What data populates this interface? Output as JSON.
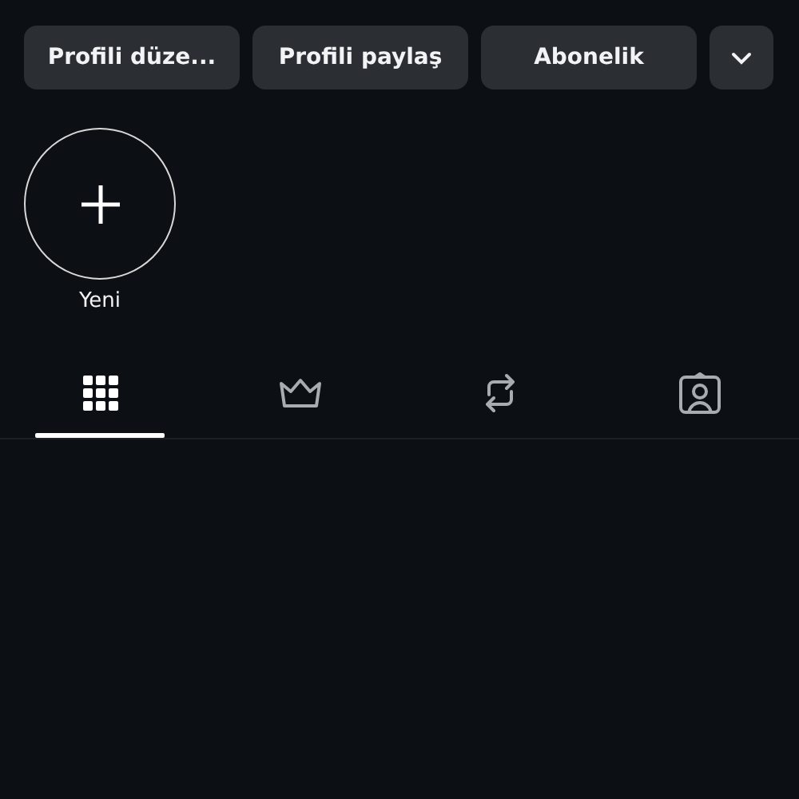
{
  "actions": [
    {
      "label": "Profili düze..."
    },
    {
      "label": "Profili paylaş"
    },
    {
      "label": "Abonelik"
    }
  ],
  "more_button": {
    "kind": "chevron"
  },
  "highlights": [
    {
      "label": "Yeni",
      "kind": "new"
    }
  ],
  "tabs": [
    {
      "kind": "grid",
      "selected": true
    },
    {
      "kind": "crown",
      "selected": false
    },
    {
      "kind": "repost",
      "selected": false
    },
    {
      "kind": "tagged",
      "selected": false
    }
  ]
}
